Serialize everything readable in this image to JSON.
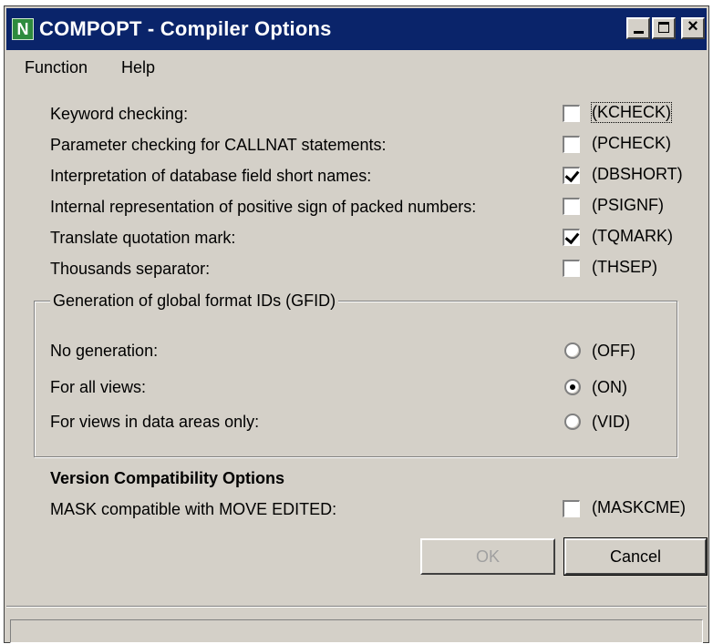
{
  "window": {
    "title": "COMPOPT - Compiler Options",
    "app_icon_letter": "N"
  },
  "menu": [
    "Function",
    "Help"
  ],
  "options": [
    {
      "label": "Keyword checking:",
      "code": "(KCHECK)",
      "checked": false
    },
    {
      "label": "Parameter checking for CALLNAT statements:",
      "code": "(PCHECK)",
      "checked": false
    },
    {
      "label": "Interpretation of database field short names:",
      "code": "(DBSHORT)",
      "checked": true
    },
    {
      "label": "Internal representation of positive sign of packed numbers:",
      "code": "(PSIGNF)",
      "checked": false
    },
    {
      "label": "Translate quotation mark:",
      "code": "(TQMARK)",
      "checked": true
    },
    {
      "label": "Thousands separator:",
      "code": "(THSEP)",
      "checked": false
    }
  ],
  "gfid_group": {
    "title": "Generation of global format IDs (GFID)",
    "choices": [
      {
        "label": "No generation:",
        "code": "(OFF)",
        "selected": false
      },
      {
        "label": "For all views:",
        "code": "(ON)",
        "selected": true
      },
      {
        "label": "For views in data areas only:",
        "code": "(VID)",
        "selected": false
      }
    ]
  },
  "version_compat": {
    "heading": "Version Compatibility Options",
    "label": "MASK compatible with MOVE EDITED:",
    "code": "(MASKCME)",
    "checked": false
  },
  "buttons": {
    "ok": "OK",
    "cancel": "Cancel"
  },
  "status_text": ""
}
